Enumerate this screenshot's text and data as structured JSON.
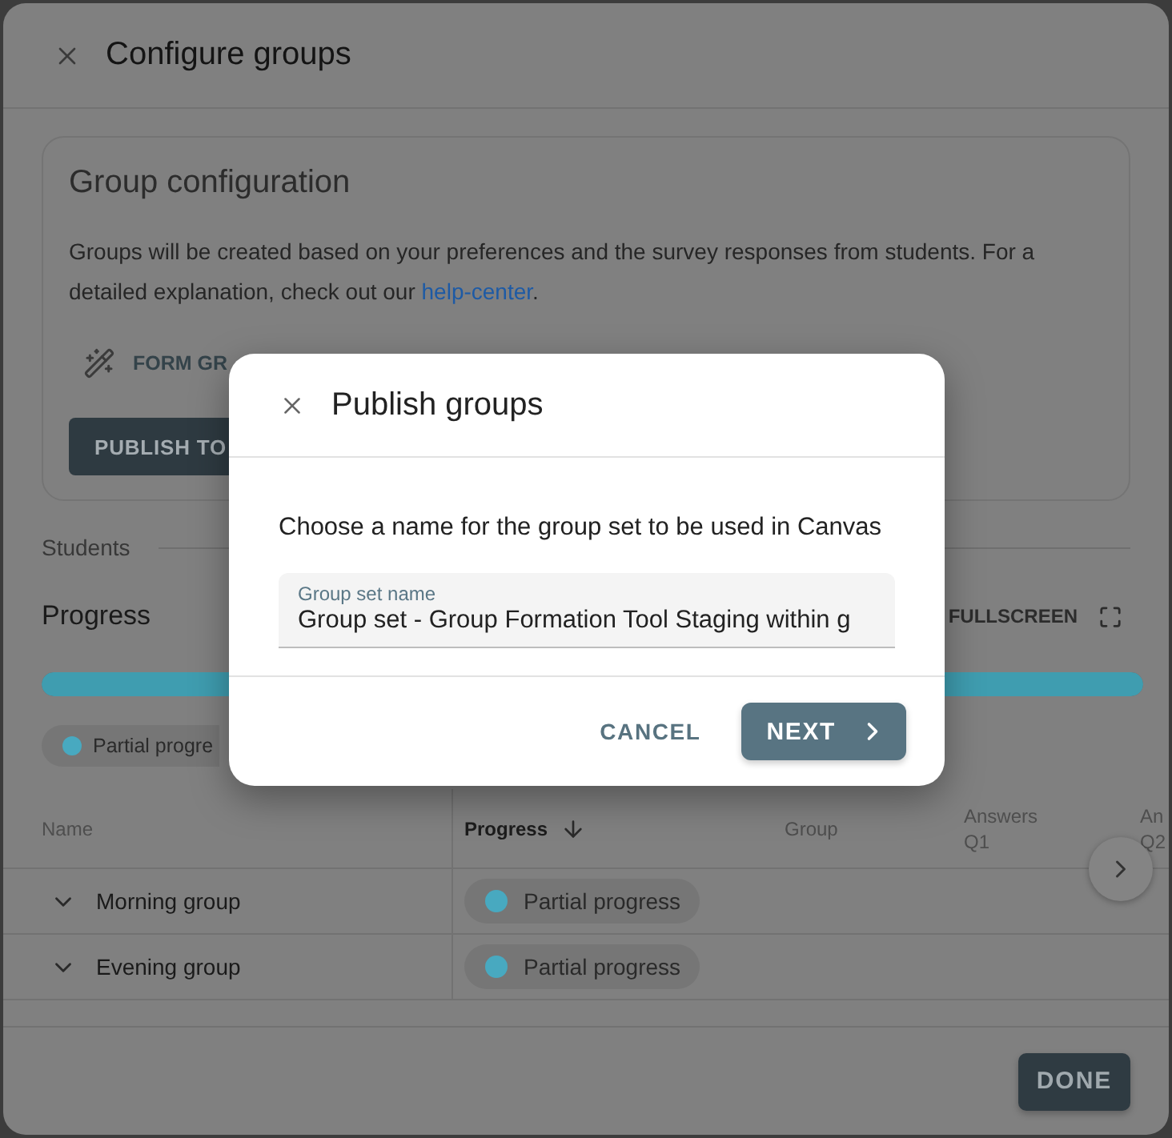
{
  "window": {
    "title": "Configure groups"
  },
  "group_configuration": {
    "title": "Group configuration",
    "description": "Groups will be created based on your preferences and the survey responses from students. For a detailed explanation, check out our ",
    "link": "help-center",
    "description_end": ".",
    "form_button": "FORM GR",
    "publish_button": "PUBLISH TO"
  },
  "students": {
    "label": "Students",
    "progress_title": "Progress",
    "fullscreen_button": "FULLSCREEN",
    "progress_bar": {
      "level": 1
    },
    "legend": [
      {
        "label": "Partial progre",
        "color": "#48a9c0"
      }
    ]
  },
  "table": {
    "columns": [
      {
        "lines": [
          "Name"
        ],
        "sorted": false
      },
      {
        "lines": [
          "Progress"
        ],
        "sorted": true
      },
      {
        "lines": [
          "Group"
        ],
        "sorted": false
      },
      {
        "lines": [
          "Answers",
          "Q1"
        ],
        "sorted": false
      },
      {
        "lines": [
          "An",
          "Q2"
        ],
        "sorted": false
      }
    ],
    "rows": [
      {
        "name": "Morning group",
        "expanded": false,
        "progress": {
          "label": "Partial progress",
          "color": "#48a9c0"
        }
      },
      {
        "name": "Evening group",
        "expanded": false,
        "progress": {
          "label": "Partial progress",
          "color": "#48a9c0"
        }
      }
    ]
  },
  "footer": {
    "done_button": "DONE"
  },
  "dialog": {
    "title": "Publish groups",
    "prompt": "Choose a name for the group set to be used in Canvas",
    "field": {
      "label": "Group set name",
      "value": "Group set - Group Formation Tool Staging within g"
    },
    "buttons": [
      {
        "label": "CANCEL",
        "kind": "text"
      },
      {
        "label": "NEXT",
        "kind": "primary"
      }
    ]
  }
}
